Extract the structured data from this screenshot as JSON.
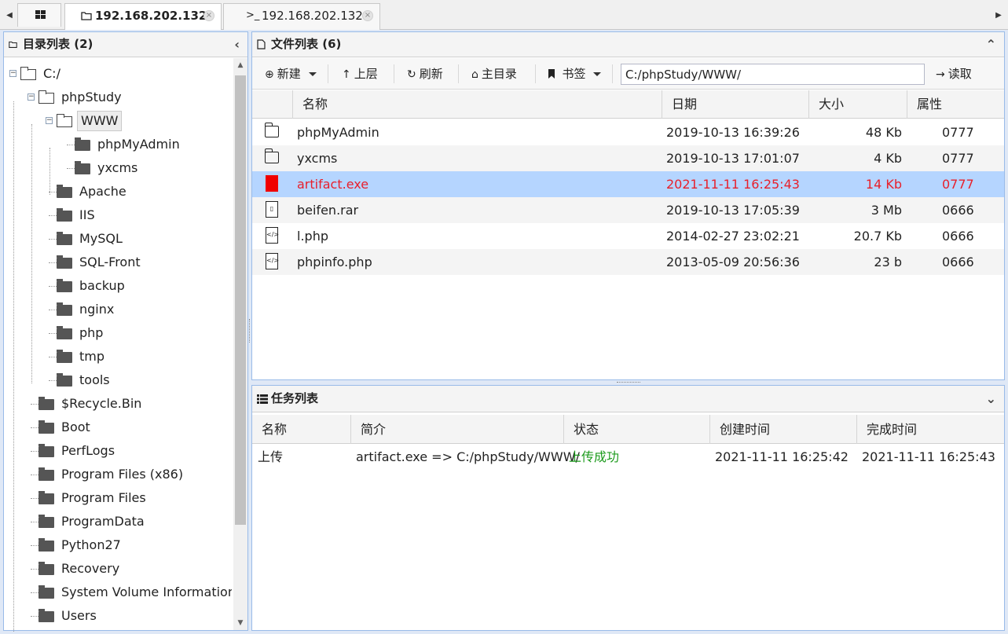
{
  "tabs": [
    {
      "label": "192.168.202.132",
      "icon": "folder-icon",
      "active": true
    },
    {
      "label": "192.168.202.132",
      "icon": "terminal-icon",
      "icon_glyph": ">_",
      "active": false
    }
  ],
  "tab_close_glyph": "×",
  "dir_panel": {
    "title": "目录列表 (2)",
    "collapse_glyph": "‹",
    "tree": [
      {
        "label": "C:/",
        "depth": 0,
        "open": true,
        "expander": "−"
      },
      {
        "label": "phpStudy",
        "depth": 1,
        "open": true,
        "expander": "−"
      },
      {
        "label": "WWW",
        "depth": 2,
        "open": true,
        "selected": true,
        "expander": "−"
      },
      {
        "label": "phpMyAdmin",
        "depth": 3
      },
      {
        "label": "yxcms",
        "depth": 3
      },
      {
        "label": "Apache",
        "depth": 2
      },
      {
        "label": "IIS",
        "depth": 2
      },
      {
        "label": "MySQL",
        "depth": 2
      },
      {
        "label": "SQL-Front",
        "depth": 2
      },
      {
        "label": "backup",
        "depth": 2
      },
      {
        "label": "nginx",
        "depth": 2
      },
      {
        "label": "php",
        "depth": 2
      },
      {
        "label": "tmp",
        "depth": 2
      },
      {
        "label": "tools",
        "depth": 2
      },
      {
        "label": "$Recycle.Bin",
        "depth": 1
      },
      {
        "label": "Boot",
        "depth": 1
      },
      {
        "label": "PerfLogs",
        "depth": 1
      },
      {
        "label": "Program Files (x86)",
        "depth": 1
      },
      {
        "label": "Program Files",
        "depth": 1
      },
      {
        "label": "ProgramData",
        "depth": 1
      },
      {
        "label": "Python27",
        "depth": 1
      },
      {
        "label": "Recovery",
        "depth": 1
      },
      {
        "label": "System Volume Information",
        "depth": 1
      },
      {
        "label": "Users",
        "depth": 1
      }
    ]
  },
  "file_panel": {
    "title": "文件列表 (6)",
    "collapse_glyph": "⌃",
    "toolbar": {
      "new_label": "新建",
      "up_label": "上层",
      "refresh_label": "刷新",
      "home_label": "主目录",
      "bookmark_label": "书签",
      "path_value": "C:/phpStudy/WWW/",
      "read_label": "读取"
    },
    "columns": [
      "名称",
      "日期",
      "大小",
      "属性"
    ],
    "rows": [
      {
        "name": "phpMyAdmin",
        "date": "2019-10-13 16:39:26",
        "size": "48 Kb",
        "attr": "0777",
        "kind": "folder"
      },
      {
        "name": "yxcms",
        "date": "2019-10-13 17:01:07",
        "size": "4 Kb",
        "attr": "0777",
        "kind": "folder"
      },
      {
        "name": "artifact.exe",
        "date": "2021-11-11 16:25:43",
        "size": "14 Kb",
        "attr": "0777",
        "kind": "exe",
        "selected": true
      },
      {
        "name": "beifen.rar",
        "date": "2019-10-13 17:05:39",
        "size": "3 Mb",
        "attr": "0666",
        "kind": "archive"
      },
      {
        "name": "l.php",
        "date": "2014-02-27 23:02:21",
        "size": "20.7 Kb",
        "attr": "0666",
        "kind": "code"
      },
      {
        "name": "phpinfo.php",
        "date": "2013-05-09 20:56:36",
        "size": "23 b",
        "attr": "0666",
        "kind": "code"
      }
    ]
  },
  "task_panel": {
    "title": "任务列表",
    "collapse_glyph": "⌄",
    "columns": [
      "名称",
      "简介",
      "状态",
      "创建时间",
      "完成时间"
    ],
    "rows": [
      {
        "name": "上传",
        "desc": "artifact.exe => C:/phpStudy/WWW/",
        "status": "上传成功",
        "created": "2021-11-11 16:25:42",
        "finished": "2021-11-11 16:25:43"
      }
    ]
  },
  "colors": {
    "selected_row": "#b5d5ff",
    "selected_text": "#e8202a",
    "success": "#1d9b1d",
    "panel_border": "#99bbe8"
  }
}
